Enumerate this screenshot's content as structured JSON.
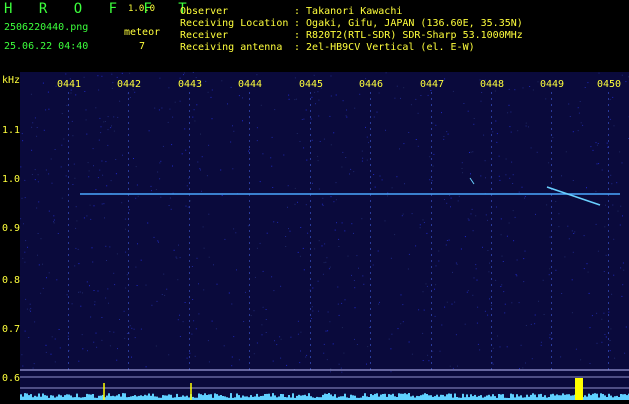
{
  "app": {
    "logo": "H R O F F T",
    "version": "1.0.0",
    "filename": "2506220440.png",
    "datetime": "25.06.22 04:40",
    "meteor_label": "meteor",
    "meteor_count": "7"
  },
  "info": {
    "labels": [
      "Observer",
      "Receiving Location",
      "Receiver",
      "Receiving antenna"
    ],
    "values": [
      ": Takanori Kawachi",
      ": Ogaki, Gifu, JAPAN (136.60E, 35.35N)",
      ": R820T2(RTL-SDR) SDR-Sharp 53.1000MHz",
      ": 2el-HB9CV Vertical (el. E-W)"
    ]
  },
  "axes": {
    "unit": "kHz",
    "y_ticks": [
      "1.1",
      "1.0",
      "0.9",
      "0.8",
      "0.7",
      "0.6"
    ],
    "x_ticks": [
      "0441",
      "0442",
      "0443",
      "0444",
      "0445",
      "0446",
      "0447",
      "0448",
      "0449",
      "0450"
    ]
  },
  "colors": {
    "background": "#0a0a3c",
    "text_green": "#3cff3c",
    "text_yellow": "#ffff3c",
    "signal": "#4aa8ff",
    "baseline": "#5fd0ff"
  }
}
